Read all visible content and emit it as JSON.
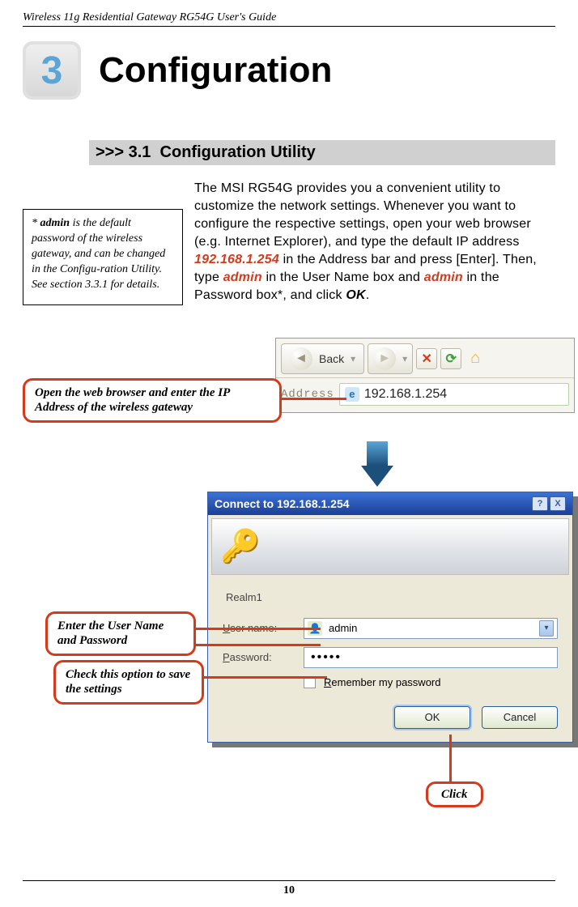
{
  "header": {
    "running_title": "Wireless 11g Residential Gateway RG54G User's Guide"
  },
  "chapter": {
    "number": "3",
    "title": "Configuration"
  },
  "section": {
    "chevrons": ">>>",
    "number": "3.1",
    "title": "Configuration Utility"
  },
  "note": {
    "prefix": "* ",
    "bold_word": "admin",
    "rest": " is the default password of the wireless gateway, and can be changed in the Configu-ration Utility.  See section 3.3.1 for details."
  },
  "body": {
    "p1a": "The MSI RG54G provides you a convenient utility to customize the network settings.  Whenever you want to configure the respective settings, open your web browser (e.g. Internet Explorer), and type the default IP address ",
    "ip": "192.168.1.254",
    "p1b": " in the Address bar and press [Enter].  Then, type ",
    "cred1": "admin",
    "p1c": " in the User Name box and ",
    "cred2": "admin",
    "p1d": " in the Password box*, and click ",
    "ok": "OK",
    "p1e": "."
  },
  "toolbar": {
    "back_label": "Back",
    "address_label": "Address",
    "address_value": "192.168.1.254",
    "stop_glyph": "✕",
    "refresh_glyph": "⟳",
    "home_glyph": "⌂",
    "back_glyph": "◄",
    "chev_glyph": "▾",
    "ie_glyph": "e"
  },
  "callouts": {
    "open_browser": "Open the web browser and enter the IP Address of the wireless gateway",
    "enter_creds": "Enter the User Name and Password",
    "check_option": "Check this option to save the settings",
    "click": "Click"
  },
  "dialog": {
    "title": "Connect to 192.168.1.254",
    "help_glyph": "?",
    "close_glyph": "X",
    "realm": "Realm1",
    "username_label_u": "U",
    "username_label_rest": "ser name:",
    "password_label_u": "P",
    "password_label_rest": "assword:",
    "username_value": "admin",
    "password_masked": "•••••",
    "remember_u": "R",
    "remember_rest": "emember my password",
    "ok": "OK",
    "cancel": "Cancel",
    "drop_glyph": "▾",
    "user_icon_glyph": "👤",
    "key_glyph": "🔑"
  },
  "footer": {
    "page": "10"
  }
}
